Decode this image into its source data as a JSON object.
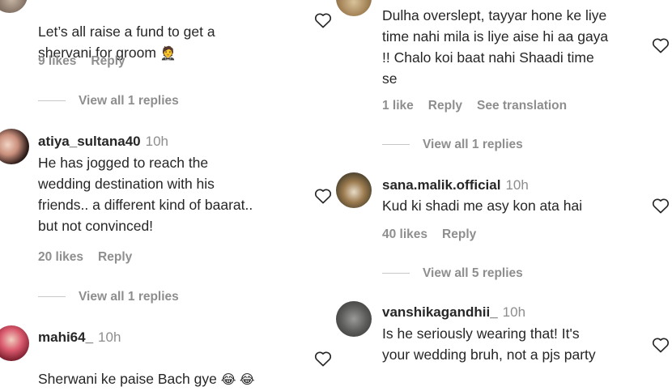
{
  "left": {
    "c1": {
      "text": "Let’s all raise a fund to get a\nshervani for groom",
      "emoji": "🤵",
      "likes": "9 likes",
      "reply": "Reply",
      "view_replies": "View all 1 replies"
    },
    "c2": {
      "username": "atiya_sultana40",
      "time": "10h",
      "text": "He has jogged to reach the\nwedding destination with his\nfriends.. a different kind of baarat..\nbut not convinced!",
      "likes": "20 likes",
      "reply": "Reply",
      "view_replies": "View all 1 replies"
    },
    "c3": {
      "username": "mahi64_",
      "time": "10h",
      "text": "Sherwani ke paise Bach gye",
      "emoji": "😂 😂"
    }
  },
  "right": {
    "c1": {
      "text": "Dulha overslept, tayyar hone ke liye\ntime nahi mila is liye aise hi aa gaya\n!! Chalo koi baat nahi Shaadi time\nse",
      "likes": "1 like",
      "reply": "Reply",
      "see_translation": "See translation",
      "view_replies": "View all 1 replies"
    },
    "c2": {
      "username": "sana.malik.official",
      "time": "10h",
      "text": "Kud ki shadi me asy kon ata hai",
      "likes": "40 likes",
      "reply": "Reply",
      "view_replies": "View all 5 replies"
    },
    "c3": {
      "username": "vanshikagandhii_",
      "time": "10h",
      "text": "Is he seriously wearing that! It's\nyour wedding bruh, not a pjs party"
    }
  },
  "icons": {
    "like": "heart-outline-icon"
  }
}
